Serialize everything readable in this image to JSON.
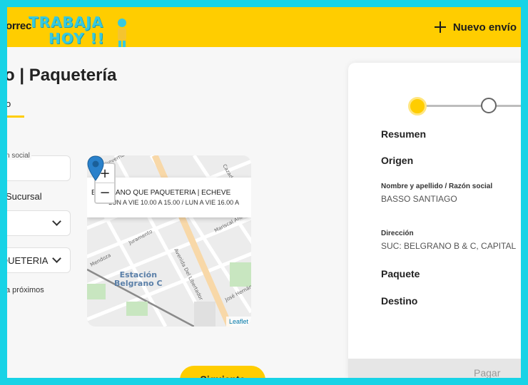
{
  "header": {
    "brand": "orrec",
    "watermark_line1": "TRABAJA",
    "watermark_line2": "HOY !!",
    "new_shipment_label": "Nuevo envío"
  },
  "page": {
    "title": "o | Paquetería",
    "tab_active": "o"
  },
  "form": {
    "field_label": "n social",
    "sucursal_label": "Sucursal",
    "select_sucursal_value": "",
    "select_branch_value": "QUETERIA",
    "next_dates_text": "a próximos"
  },
  "map": {
    "zoom_in": "+",
    "zoom_out": "−",
    "popup_title": "BELGRANO QUE PAQUETERIA | ECHEVE",
    "popup_hours": "LUN A VIE 10.00 A 15.00 / LUN A VIE 16.00 A",
    "station_line1": "Estación",
    "station_line2": "Belgrano C",
    "street_labels": [
      "Juramento",
      "Avenida Del Libertador",
      "Mariscal Antonio",
      "José Hernández",
      "Echeverría",
      "Mendoza",
      "Cazadores"
    ],
    "attribution": "Leaflet"
  },
  "actions": {
    "next_label": "Siguiente"
  },
  "summary": {
    "heading": "Resumen",
    "origin_heading": "Origen",
    "name_label": "Nombre y apellido / Razón social",
    "name_value": "BASSO SANTIAGO",
    "address_label": "Dirección",
    "address_value": "SUC: BELGRANO B & C, CAPITAL",
    "package_heading": "Paquete",
    "destination_heading": "Destino",
    "pay_label": "Pagar"
  },
  "colors": {
    "brand_yellow": "#ffcd00",
    "frame_cyan": "#18d3e6",
    "link_blue": "#0078a8"
  }
}
